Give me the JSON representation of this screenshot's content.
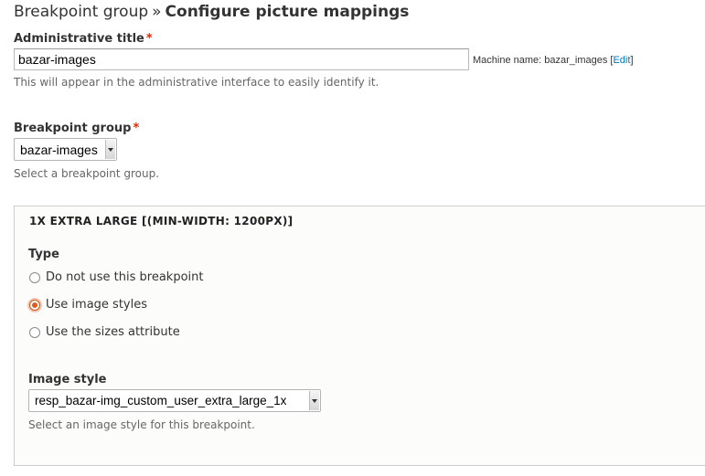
{
  "header": {
    "breadcrumb": "Breakpoint group",
    "separator": "»",
    "title": "Configure picture mappings"
  },
  "admin_title": {
    "label": "Administrative title",
    "required_mark": "*",
    "value": "bazar-images",
    "machine_name_prefix": "Machine name: bazar_images [",
    "edit_link": "Edit",
    "machine_name_suffix": "]",
    "description": "This will appear in the administrative interface to easily identify it."
  },
  "breakpoint_group": {
    "label": "Breakpoint group",
    "required_mark": "*",
    "selected": "bazar-images",
    "description": "Select a breakpoint group."
  },
  "breakpoint_fieldset": {
    "legend": "1X EXTRA LARGE [(MIN-WIDTH: 1200PX)]",
    "type_label": "Type",
    "options": [
      {
        "label": "Do not use this breakpoint",
        "checked": false
      },
      {
        "label": "Use image styles",
        "checked": true
      },
      {
        "label": "Use the sizes attribute",
        "checked": false
      }
    ],
    "image_style_label": "Image style",
    "image_style_selected": "resp_bazar-img_custom_user_extra_large_1x",
    "image_style_description": "Select an image style for this breakpoint."
  },
  "colors": {
    "required": "#e32700",
    "link": "#0074bd",
    "radio_checked": "#e05a1c"
  }
}
